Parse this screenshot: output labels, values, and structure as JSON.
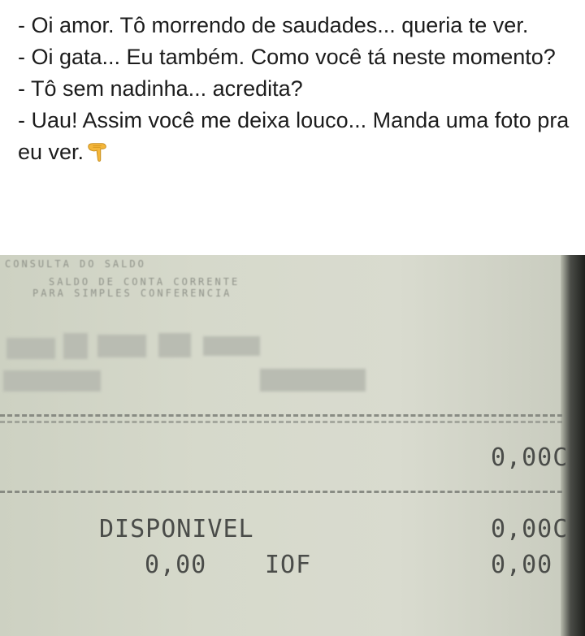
{
  "post": {
    "lines": [
      "- Oi amor. Tô morrendo de saudades... queria te ver.",
      "- Oi gata... Eu também. Como você tá neste momento?",
      "- Tô sem nadinha... acredita?",
      "- Uau! Assim você me deixa louco... Manda uma foto pra eu ver."
    ],
    "emoji_icon": "pointing-down-hand-icon"
  },
  "receipt": {
    "header_1": "CONSULTA DO SALDO",
    "header_2": "SALDO DE CONTA CORRENTE",
    "header_3": "PARA SIMPLES CONFERENCIA",
    "balance_value": "0,00C",
    "available_label": "DISPONIVEL",
    "available_value": "0,00C",
    "iof_amount": "0,00",
    "iof_label": "IOF",
    "iof_value": "0,00"
  }
}
